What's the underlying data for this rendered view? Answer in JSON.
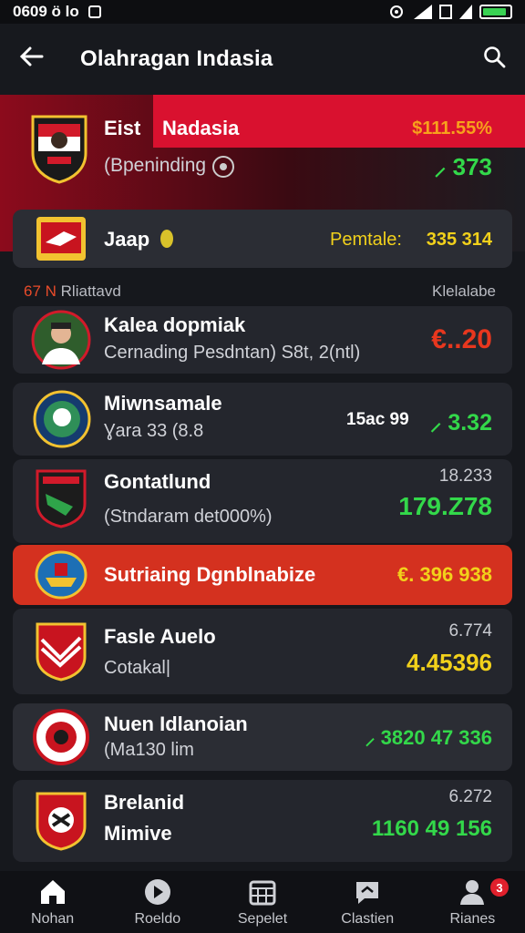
{
  "status_bar": {
    "time": "0609 ö lo",
    "battery_color": "#39d353"
  },
  "header": {
    "title": "Olahragan  Indasia"
  },
  "hero": {
    "label_left": "Eist",
    "label_right": "Nadasia",
    "value_top": "$111.55%",
    "subtitle": "(Bpeninding",
    "value_bottom": "373"
  },
  "featured": {
    "name": "Jaap",
    "label": "Pemtale:",
    "value": "335  314"
  },
  "section": {
    "left_prefix": "67 N",
    "left": "Rliattavd",
    "right": "Klelalabe"
  },
  "rows": [
    {
      "name": "Kalea dopmiak",
      "sub": "Cernading Pesdntan) S8t, 2(ntl)",
      "value_small": "",
      "value": "€..20",
      "value_color": "red"
    },
    {
      "name": "Miwnsamale",
      "sub": "Ɣara 33 (8.8",
      "value_small": "15ac 99",
      "value": "3.32",
      "value_color": "green"
    },
    {
      "name": "Gontatlund",
      "sub": "(Stndaram det000%)",
      "value_small": "18.233",
      "value": "179.Z78",
      "value_color": "green"
    },
    {
      "name": "Sutriaing Dgnblnabize",
      "sub": "",
      "value_small": "",
      "value": "€. 396  938",
      "value_color": "yellow",
      "highlight": true
    },
    {
      "name": "Fasle Auelo",
      "sub": "Cotakal|",
      "value_small": "6.774",
      "value": "4.45396",
      "value_color": "yellow"
    },
    {
      "name": "Nuen Idlanoian",
      "sub": "(Ma130 lim",
      "value_small": "",
      "value": "3820  47 336",
      "value_color": "green"
    },
    {
      "name": "Brelanid",
      "sub": "Mimive",
      "value_small": "6.272",
      "value": "1160 49 156",
      "value_color": "green"
    }
  ],
  "tabs": [
    {
      "label": "Nohan",
      "icon": "home-icon"
    },
    {
      "label": "Roeldo",
      "icon": "play-circle-icon"
    },
    {
      "label": "Sepelet",
      "icon": "calendar-grid-icon"
    },
    {
      "label": "Clastien",
      "icon": "chat-bubble-icon"
    },
    {
      "label": "Rianes",
      "icon": "user-icon",
      "badge": "3"
    }
  ]
}
